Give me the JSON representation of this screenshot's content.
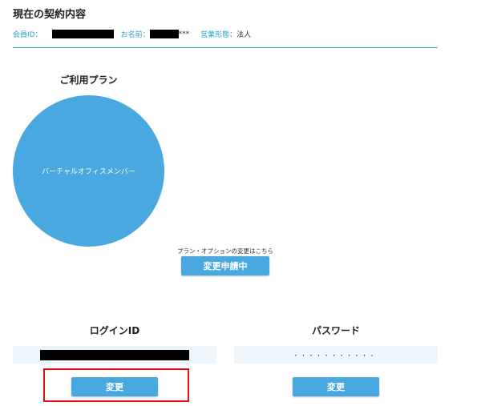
{
  "page": {
    "title": "現在の契約内容"
  },
  "member_info": {
    "member_id_label": "会員ID：",
    "name_label": "お名前：",
    "name_suffix": "***",
    "business_type_label": "営業形態：",
    "business_type_value": "法人"
  },
  "plan": {
    "heading": "ご利用プラン",
    "name": "バーチャルオフィスメンバー",
    "color": "#4aa8e0"
  },
  "plan_change": {
    "note": "プラン・オプションの変更はこちら",
    "button_label": "変更申請中"
  },
  "login_id": {
    "heading": "ログインID",
    "button_label": "変更"
  },
  "password": {
    "heading": "パスワード",
    "masked_value": "･･･････････",
    "button_label": "変更"
  },
  "colors": {
    "accent": "#4aa8e0",
    "label_blue": "#2a9ec9",
    "divider": "#3aa89a",
    "highlight": "#e01010",
    "field_bg": "#eef5fb"
  }
}
